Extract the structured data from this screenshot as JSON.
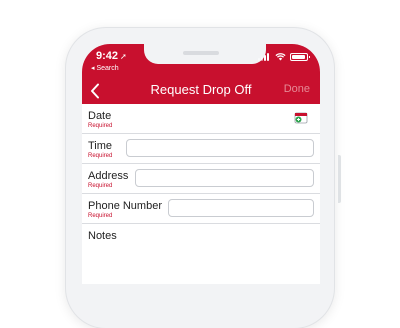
{
  "status": {
    "time": "9:42",
    "location_glyph": "➚",
    "back_app": "◂ Search"
  },
  "nav": {
    "title": "Request Drop Off",
    "done_label": "Done"
  },
  "form": {
    "date_label": "Date",
    "date_required": "Required",
    "time_label": "Time",
    "time_required": "Required",
    "time_value": "",
    "address_label": "Address",
    "address_required": "Required",
    "address_value": "",
    "phone_label": "Phone Number",
    "phone_required": "Required",
    "phone_value": "",
    "notes_label": "Notes"
  },
  "colors": {
    "brand_red": "#c8102e",
    "done_disabled": "#e68a96"
  }
}
